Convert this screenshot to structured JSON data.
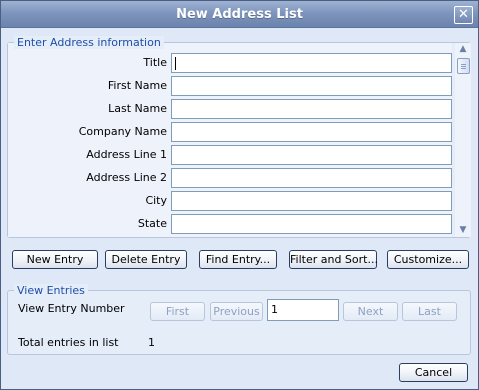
{
  "window": {
    "title": "New Address List",
    "close_glyph": "✕"
  },
  "address": {
    "legend": "Enter Address information",
    "fields": [
      {
        "label": "Title",
        "value": ""
      },
      {
        "label": "First Name",
        "value": ""
      },
      {
        "label": "Last Name",
        "value": ""
      },
      {
        "label": "Company Name",
        "value": ""
      },
      {
        "label": "Address Line 1",
        "value": ""
      },
      {
        "label": "Address Line 2",
        "value": ""
      },
      {
        "label": "City",
        "value": ""
      },
      {
        "label": "State",
        "value": ""
      }
    ]
  },
  "toolbar": {
    "new_entry": "New Entry",
    "delete_entry": "Delete Entry",
    "find_entry": "Find Entry...",
    "filter_sort": "Filter and Sort...",
    "customize": "Customize..."
  },
  "view": {
    "legend": "View Entries",
    "entry_number_label": "View Entry Number",
    "first": "First",
    "previous": "Previous",
    "entry_number_value": "1",
    "next": "Next",
    "last": "Last",
    "total_label": "Total entries in list",
    "total_value": "1"
  },
  "footer": {
    "cancel": "Cancel"
  },
  "colors": {
    "title_bar": "#7e95bd",
    "dialog_bg": "#dfe8f7",
    "legend_text": "#1f4ea8"
  }
}
